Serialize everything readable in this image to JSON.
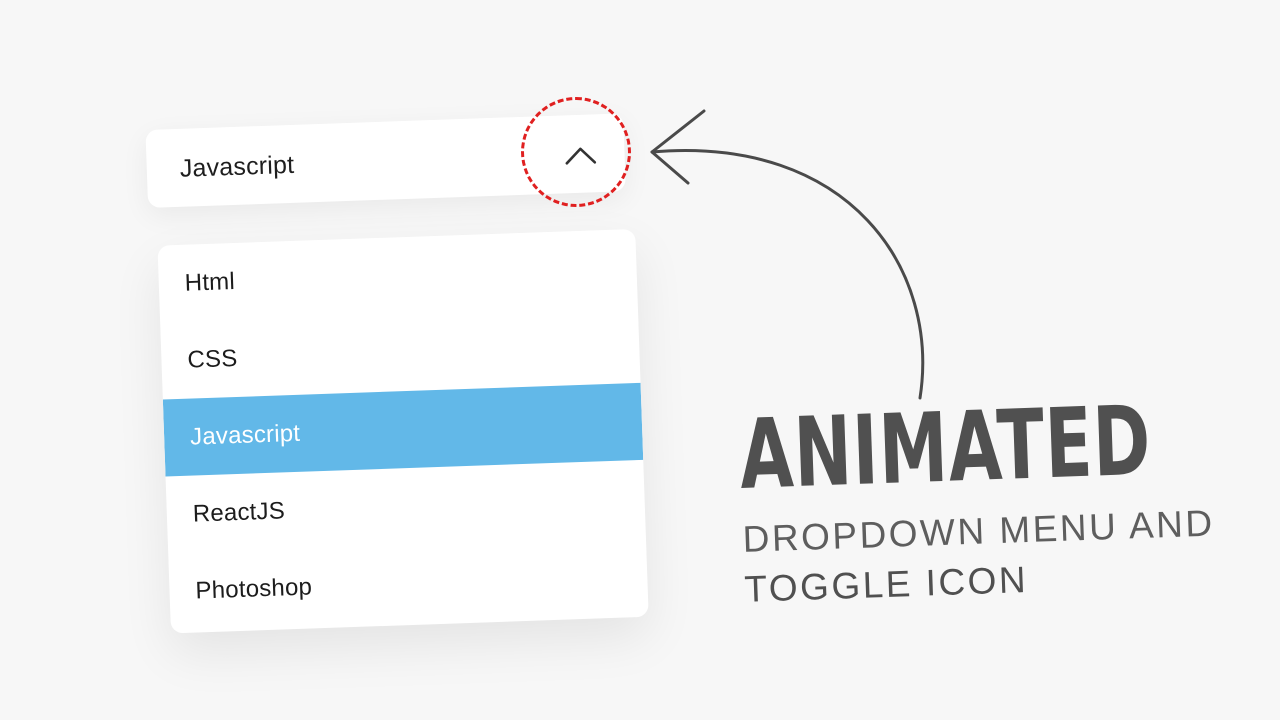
{
  "select": {
    "value": "Javascript",
    "toggle_icon": "chevron-up-icon"
  },
  "menu": {
    "items": [
      {
        "label": "Html",
        "selected": false
      },
      {
        "label": "CSS",
        "selected": false
      },
      {
        "label": "Javascript",
        "selected": true
      },
      {
        "label": "ReactJS",
        "selected": false
      },
      {
        "label": "Photoshop",
        "selected": false
      }
    ]
  },
  "annotation": {
    "highlight_color": "#e02020",
    "arrow_color": "#4a4a4a"
  },
  "title": {
    "main": "ANIMATED",
    "line1": "DROPDOWN MENU AND",
    "line2": "TOGGLE ICON"
  },
  "colors": {
    "background": "#f7f7f7",
    "selected_item": "#62b8e8",
    "selected_text": "#ffffff",
    "title_text": "#505050"
  }
}
